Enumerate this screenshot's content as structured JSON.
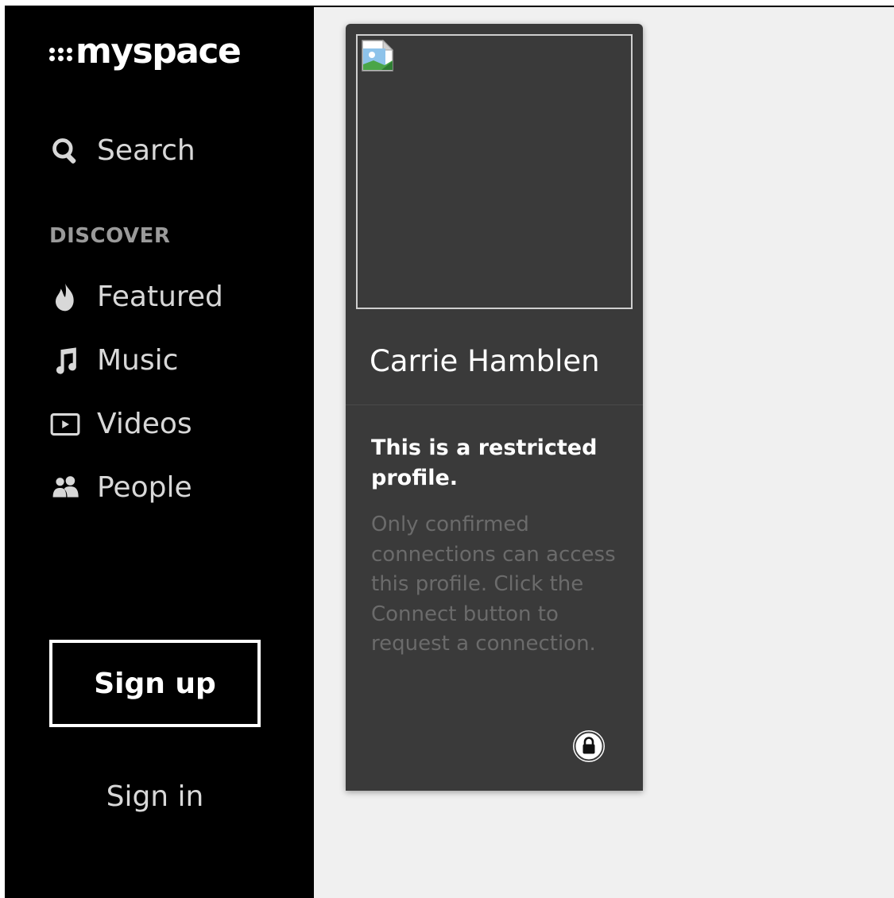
{
  "brand": {
    "logo_text": "myspace"
  },
  "sidebar": {
    "search_label": "Search",
    "discover_heading": "DISCOVER",
    "items": [
      {
        "label": "Featured",
        "icon": "flame-icon"
      },
      {
        "label": "Music",
        "icon": "music-note-icon"
      },
      {
        "label": "Videos",
        "icon": "video-play-icon"
      },
      {
        "label": "People",
        "icon": "people-icon"
      }
    ],
    "signup_label": "Sign up",
    "signin_label": "Sign in"
  },
  "profile_card": {
    "name": "Carrie Hamblen",
    "image_icon": "broken-image-icon",
    "restricted_title": "This is a restricted profile.",
    "restricted_body": "Only confirmed connections can access this profile. Click the Connect button to request a connection.",
    "lock_icon": "lock-icon"
  },
  "colors": {
    "sidebar_bg": "#000000",
    "page_bg": "#f0f0f0",
    "card_bg": "#3a3a3a",
    "nav_text": "#d8d8d8",
    "muted_text": "#6b6b6b"
  }
}
